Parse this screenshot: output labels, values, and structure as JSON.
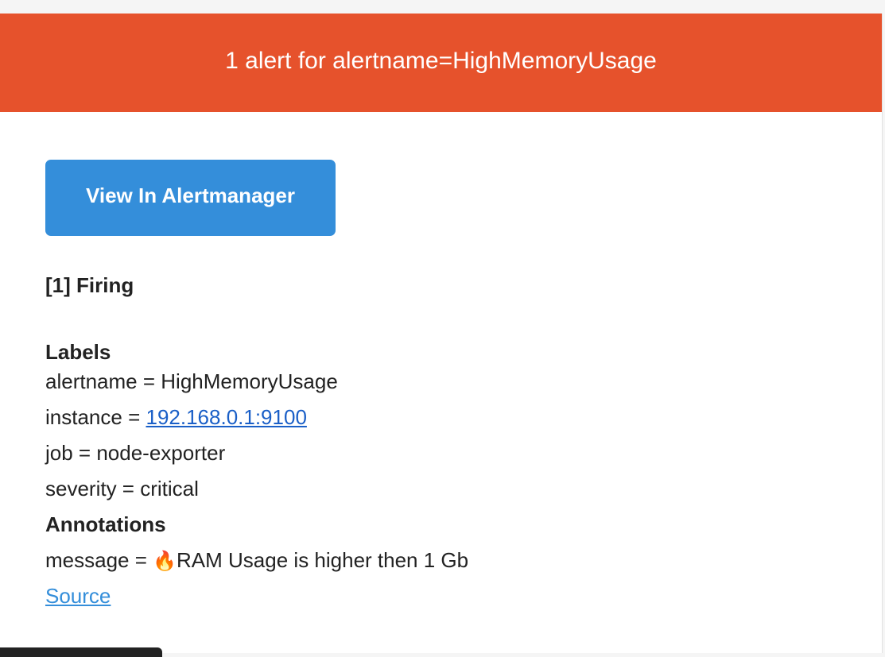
{
  "header": {
    "title": "1 alert for alertname=HighMemoryUsage"
  },
  "actions": {
    "view_button_label": "View In Alertmanager"
  },
  "alert": {
    "status_heading": "[1] Firing",
    "labels_heading": "Labels",
    "labels": {
      "alertname": {
        "key": "alertname",
        "sep": " = ",
        "value": "HighMemoryUsage"
      },
      "instance": {
        "key": "instance",
        "sep": " = ",
        "value": "192.168.0.1:9100"
      },
      "job": {
        "key": "job",
        "sep": " = ",
        "value": "node-exporter"
      },
      "severity": {
        "key": "severity",
        "sep": " = ",
        "value": "critical"
      }
    },
    "annotations_heading": "Annotations",
    "annotations": {
      "message": {
        "key": "message",
        "sep": " = ",
        "emoji": "🔥",
        "value": "RAM Usage is higher then 1 Gb"
      }
    },
    "source_link": "Source"
  },
  "colors": {
    "header_bg": "#e6522c",
    "button_bg": "#348eda",
    "link_blue": "#1a5fc7"
  }
}
